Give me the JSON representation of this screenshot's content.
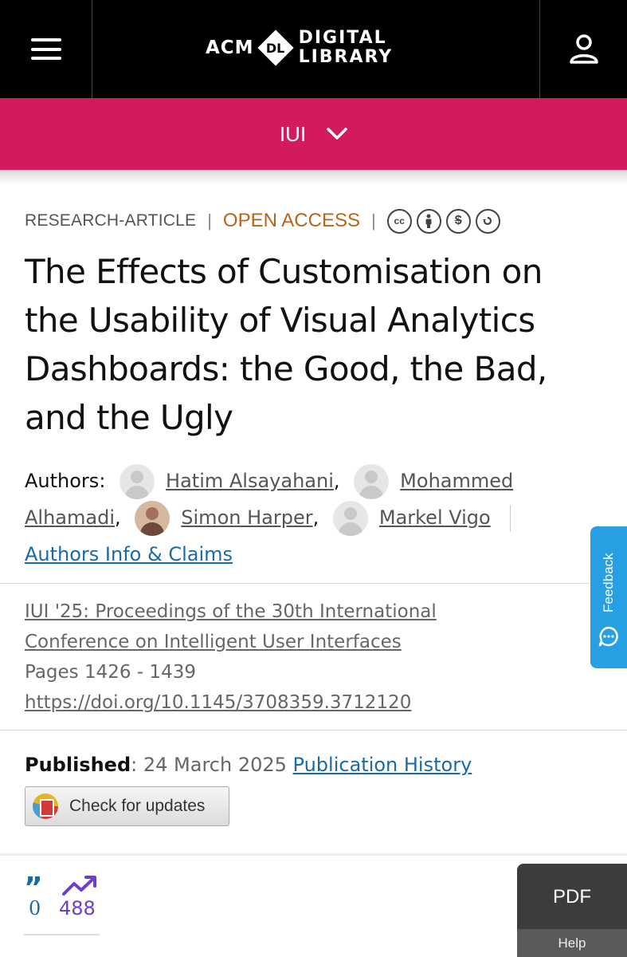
{
  "header": {
    "logo_acm": "ACM",
    "logo_dl": "DL",
    "logo_digital": "DIGITAL",
    "logo_library": "LIBRARY",
    "menu_icon": "hamburger-icon",
    "user_icon": "user-icon"
  },
  "conference_bar": {
    "label": "IUI",
    "chevron_icon": "chevron-down-icon",
    "color": "#d31a5f"
  },
  "article": {
    "type": "RESEARCH-ARTICLE",
    "access": "OPEN ACCESS",
    "license_icons": [
      "cc-icon",
      "by-icon",
      "nc-icon",
      "sa-icon"
    ],
    "license_labels": [
      "cc",
      "",
      "$",
      ""
    ],
    "title": "The Effects of Customisation on the Usability of Visual Analytics Dashboards: the Good, the Bad, and the Ugly",
    "authors_label": "Authors",
    "authors": [
      {
        "name": "Hatim Alsayahani",
        "sep": ","
      },
      {
        "name": "Mohammed Alhamadi",
        "sep": ","
      },
      {
        "name": "Simon Harper",
        "sep": ","
      },
      {
        "name": "Markel Vigo",
        "sep": ""
      }
    ],
    "authors_info": "Authors Info & Claims",
    "proceedings": "IUI '25: Proceedings of the 30th International Conference on Intelligent User Interfaces",
    "pages": "Pages 1426 - 1439",
    "doi": "https://doi.org/10.1145/3708359.3712120",
    "published_label": "Published",
    "published_date": "24 March 2025",
    "publication_history": "Publication History",
    "check_updates": "Check for updates"
  },
  "metrics": {
    "citations": "0",
    "downloads": "488",
    "citation_icon": "quote-icon",
    "download_icon": "trending-up-icon"
  },
  "feedback": {
    "label": "Feedback",
    "color": "#27a0e3"
  },
  "pdf": {
    "label": "PDF",
    "help": "Help"
  }
}
